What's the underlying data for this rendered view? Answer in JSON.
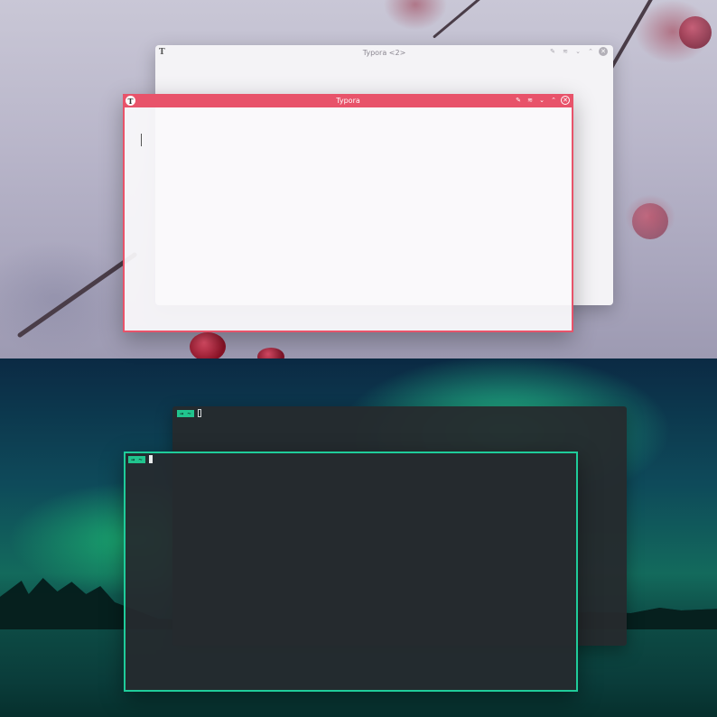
{
  "typora_back": {
    "title": "Typora <2>",
    "logo": "T",
    "controls": [
      "pin-icon",
      "keep-above-icon",
      "minimize-icon",
      "maximize-icon",
      "close-icon"
    ]
  },
  "typora_front": {
    "title": "Typora",
    "logo": "T",
    "accent_color": "#e8536a",
    "controls": [
      "pin-icon",
      "keep-above-icon",
      "minimize-icon",
      "maximize-icon",
      "close-icon"
    ]
  },
  "terminal_back": {
    "prompt": "→ ~"
  },
  "terminal_front": {
    "prompt": "→ ~",
    "accent_color": "#1fcc9a"
  },
  "icons": {
    "pin": "✎",
    "keep_above": "≋",
    "minimize": "⌄",
    "maximize": "⌃",
    "close": "✕"
  }
}
